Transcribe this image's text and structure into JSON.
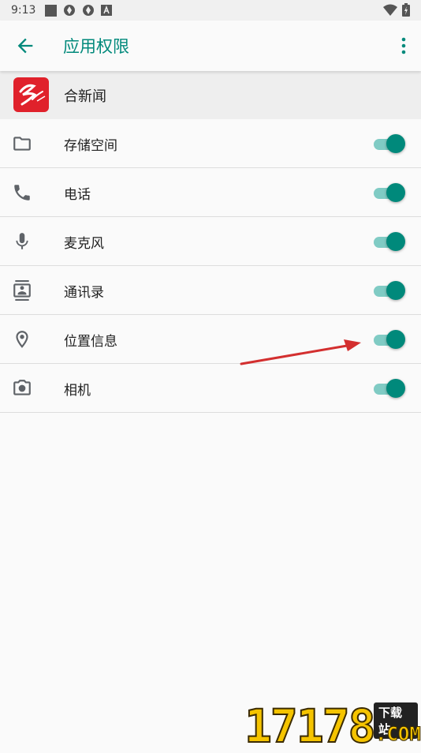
{
  "status_bar": {
    "time": "9:13"
  },
  "app_bar": {
    "title": "应用权限"
  },
  "app_header": {
    "app_name": "合新闻"
  },
  "permissions": [
    {
      "label": "存储空间",
      "icon": "folder-icon",
      "enabled": true
    },
    {
      "label": "电话",
      "icon": "phone-icon",
      "enabled": true
    },
    {
      "label": "麦克风",
      "icon": "microphone-icon",
      "enabled": true
    },
    {
      "label": "通讯录",
      "icon": "contacts-icon",
      "enabled": true
    },
    {
      "label": "位置信息",
      "icon": "location-icon",
      "enabled": true
    },
    {
      "label": "相机",
      "icon": "camera-icon",
      "enabled": true
    }
  ],
  "watermark": {
    "number": "17178",
    "badge": "下载站",
    "domain": ".COM"
  },
  "colors": {
    "accent": "#00897b",
    "track": "#80cbc4",
    "arrow": "#d32f2f"
  }
}
